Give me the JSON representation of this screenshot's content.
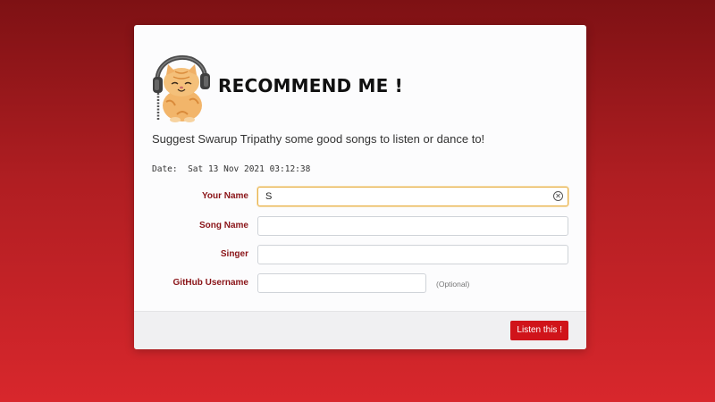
{
  "header": {
    "title": "RECOMMEND ME !",
    "logo": "cat-with-headphones"
  },
  "subtitle": "Suggest Swarup Tripathy some good songs to listen or dance to!",
  "date": {
    "label": "Date:",
    "value": "Sat 13 Nov 2021 03:12:38"
  },
  "form": {
    "name": {
      "label": "Your Name",
      "value": "S",
      "placeholder": ""
    },
    "song": {
      "label": "Song Name",
      "value": "",
      "placeholder": ""
    },
    "singer": {
      "label": "Singer",
      "value": "",
      "placeholder": ""
    },
    "github": {
      "label": "GitHub Username",
      "value": "",
      "placeholder": "",
      "note": "(Optional)"
    }
  },
  "submit": {
    "label": "Listen this !"
  },
  "colors": {
    "accent": "#d0141a",
    "label": "#8a1418",
    "focus": "#e8b24a"
  },
  "icons": {
    "clear": "clear-circle-icon"
  }
}
